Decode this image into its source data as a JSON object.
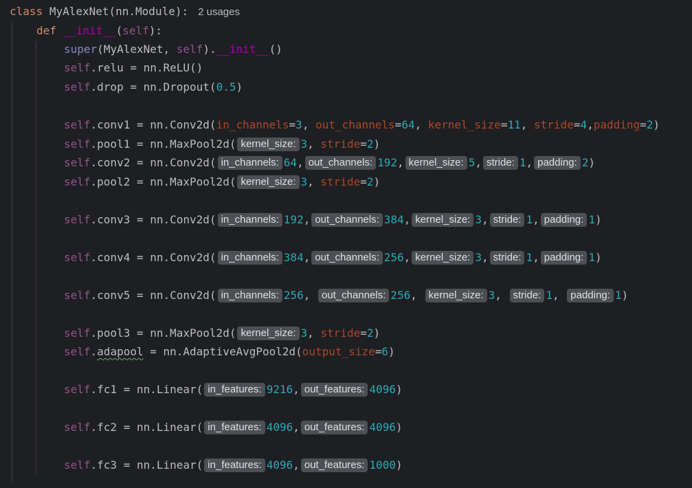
{
  "editor": {
    "usages_hint": "2 usages",
    "lines": {
      "class_kw": "class",
      "class_name": "MyAlexNet(nn.Module):",
      "def_kw": "def",
      "init_name": "__init__",
      "self": "self",
      "super": "super",
      "super_args": "MyAlexNet, ",
      "relu": ".relu = nn.ReLU()",
      "drop": ".drop = nn.Dropout(",
      "drop_val": "0.5",
      "conv1": ".conv1 = nn.Conv2d(",
      "pool1": ".pool1 = nn.MaxPool2d(",
      "conv2": ".conv2 = nn.Conv2d(",
      "pool2": ".pool2 = nn.MaxPool2d(",
      "conv3": ".conv3 = nn.Conv2d(",
      "conv4": ".conv4 = nn.Conv2d(",
      "conv5": ".conv5 = nn.Conv2d(",
      "pool3": ".pool3 = nn.MaxPool2d(",
      "adapool_name": "adapool",
      "adapool_rest": " = nn.AdaptiveAvgPool2d(",
      "fc1": ".fc1 = nn.Linear(",
      "fc2": ".fc2 = nn.Linear(",
      "fc3": ".fc3 = nn.Linear("
    },
    "params": {
      "in_channels": "in_channels",
      "out_channels": "out_channels",
      "kernel_size": "kernel_size",
      "stride": "stride",
      "padding": "padding",
      "output_size": "output_size",
      "in_features": "in_features",
      "out_features": "out_features"
    },
    "hints": {
      "in_channels": "in_channels:",
      "out_channels": "out_channels:",
      "kernel_size": "kernel_size:",
      "stride": "stride:",
      "padding": "padding:",
      "in_features": "in_features:",
      "out_features": "out_features:"
    },
    "values": {
      "conv1": [
        "3",
        "64",
        "11",
        "4",
        "2"
      ],
      "pool1": [
        "3",
        "2"
      ],
      "conv2": [
        "64",
        "192",
        "5",
        "1",
        "2"
      ],
      "pool2": [
        "3",
        "2"
      ],
      "conv3": [
        "192",
        "384",
        "3",
        "1",
        "1"
      ],
      "conv4": [
        "384",
        "256",
        "3",
        "1",
        "1"
      ],
      "conv5": [
        "256",
        "256",
        "3",
        "1",
        "1"
      ],
      "pool3": [
        "3",
        "2"
      ],
      "adapool": [
        "6"
      ],
      "fc1": [
        "9216",
        "4096"
      ],
      "fc2": [
        "4096",
        "4096"
      ],
      "fc3": [
        "4096",
        "1000"
      ]
    }
  }
}
